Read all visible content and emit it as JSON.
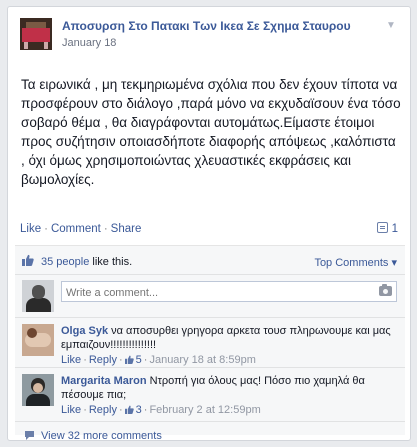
{
  "post": {
    "page_name": "Αποσυρση Στο Πατακι Των Ικεα Σε Σχημα Σταυρου",
    "date": "January 18",
    "text": "Τα ειρωνικά , μη τεκμηριωμένα σχόλια που δεν έχουν τίποτα να προσφέρουν στο διάλογο ,παρά μόνο να εκχυδαϊσουν ένα τόσο σοβαρό θέμα , θα διαγράφονται αυτομάτως.Είμαστε έτοιμοι προς συζήτησιν οποιασδήποτε διαφορής απόψεως ,καλόπιστα , όχι όμως χρησιμοποιώντας χλευαστικές εκφράσεις και βωμολοχίες."
  },
  "actions": {
    "like": "Like",
    "comment": "Comment",
    "share": "Share",
    "share_count": "1"
  },
  "likes": {
    "count_link": "35 people",
    "suffix": "like this.",
    "sort_label": "Top Comments ▾"
  },
  "compose": {
    "placeholder": "Write a comment..."
  },
  "comments": [
    {
      "author": "Olga Syk",
      "text": "να αποσυρθει γρηγορα αρκετα τουσ πληρωνουμε και μας εμπαιζουν!!!!!!!!!!!!!!!",
      "like_label": "Like",
      "reply_label": "Reply",
      "likes": "5",
      "time": "January 18 at 8:59pm"
    },
    {
      "author": "Margarita Maron",
      "text": "Ντροπή για όλους μας! Πόσο πιο χαμηλά θα πέσουμε πια;",
      "like_label": "Like",
      "reply_label": "Reply",
      "likes": "3",
      "time": "February 2 at 12:59pm"
    }
  ],
  "more_comments": "View 32 more comments",
  "colors": {
    "link": "#3b5998",
    "text": "#141823",
    "muted": "#9197a3",
    "ufi_bg": "#f6f7f8"
  },
  "icons": [
    "chevron-down-icon",
    "share-icon",
    "thumbs-up-icon",
    "camera-icon",
    "comment-bubble-icon"
  ]
}
